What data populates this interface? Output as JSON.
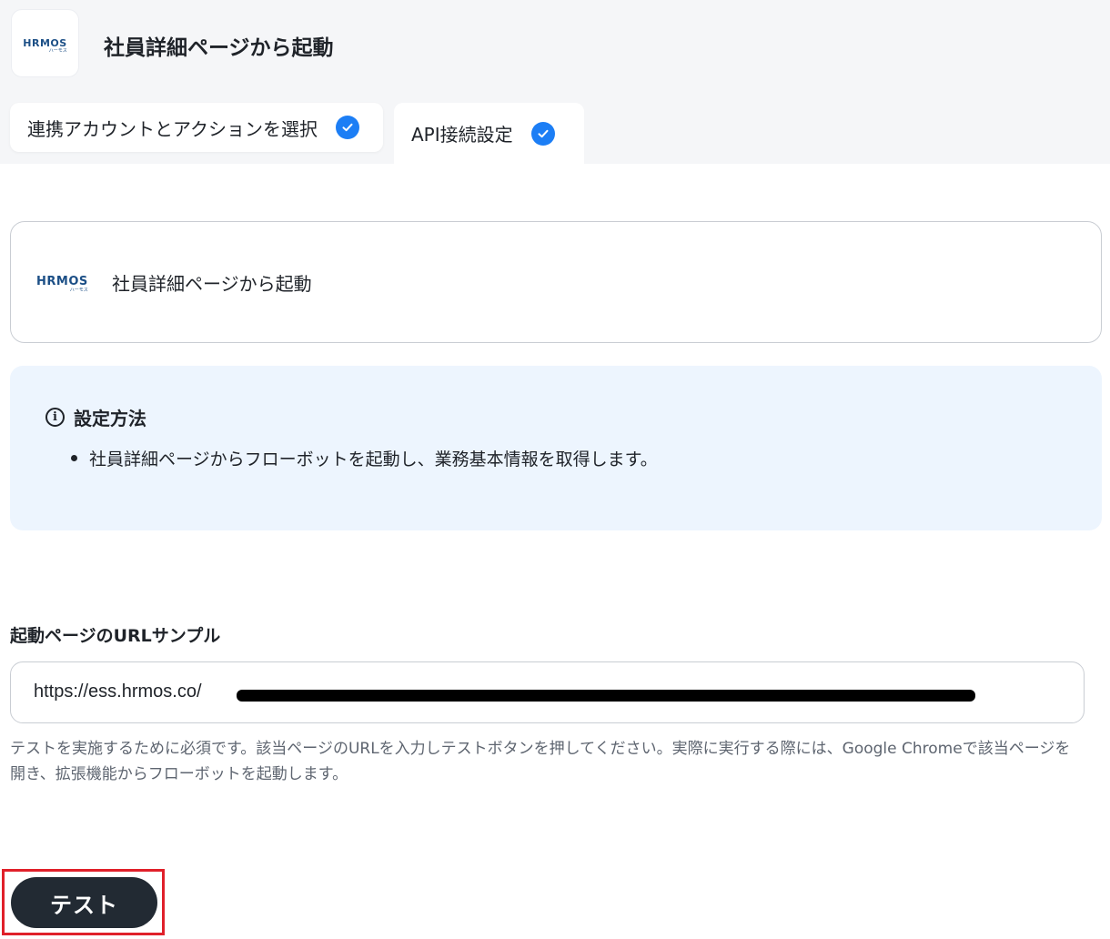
{
  "header": {
    "logo": {
      "text": "HRMOS",
      "subtext": "ハーモス"
    },
    "title": "社員詳細ページから起動"
  },
  "tabs": [
    {
      "label": "連携アカウントとアクションを選択",
      "completed": true,
      "icon": "check-circle-icon"
    },
    {
      "label": "API接続設定",
      "completed": true,
      "active": true,
      "icon": "check-circle-icon"
    }
  ],
  "trigger_card": {
    "logo_text": "HRMOS",
    "logo_subtext": "ハーモス",
    "title": "社員詳細ページから起動"
  },
  "info": {
    "icon": "info-icon",
    "heading": "設定方法",
    "items": [
      "社員詳細ページからフローボットを起動し、業務基本情報を取得します。"
    ]
  },
  "url_field": {
    "label": "起動ページのURLサンプル",
    "value_prefix": "https://ess.hrmos.co/",
    "redacted": true,
    "help": "テストを実施するために必須です。該当ページのURLを入力しテストボタンを押してください。実際に実行する際には、Google Chromeで該当ページを開き、拡張機能からフローボットを起動します。"
  },
  "actions": {
    "test_label": "テスト"
  },
  "colors": {
    "accent": "#1c7ef5",
    "info_bg": "#edf5fe",
    "button_bg": "#222a33",
    "highlight": "#e0202a"
  }
}
